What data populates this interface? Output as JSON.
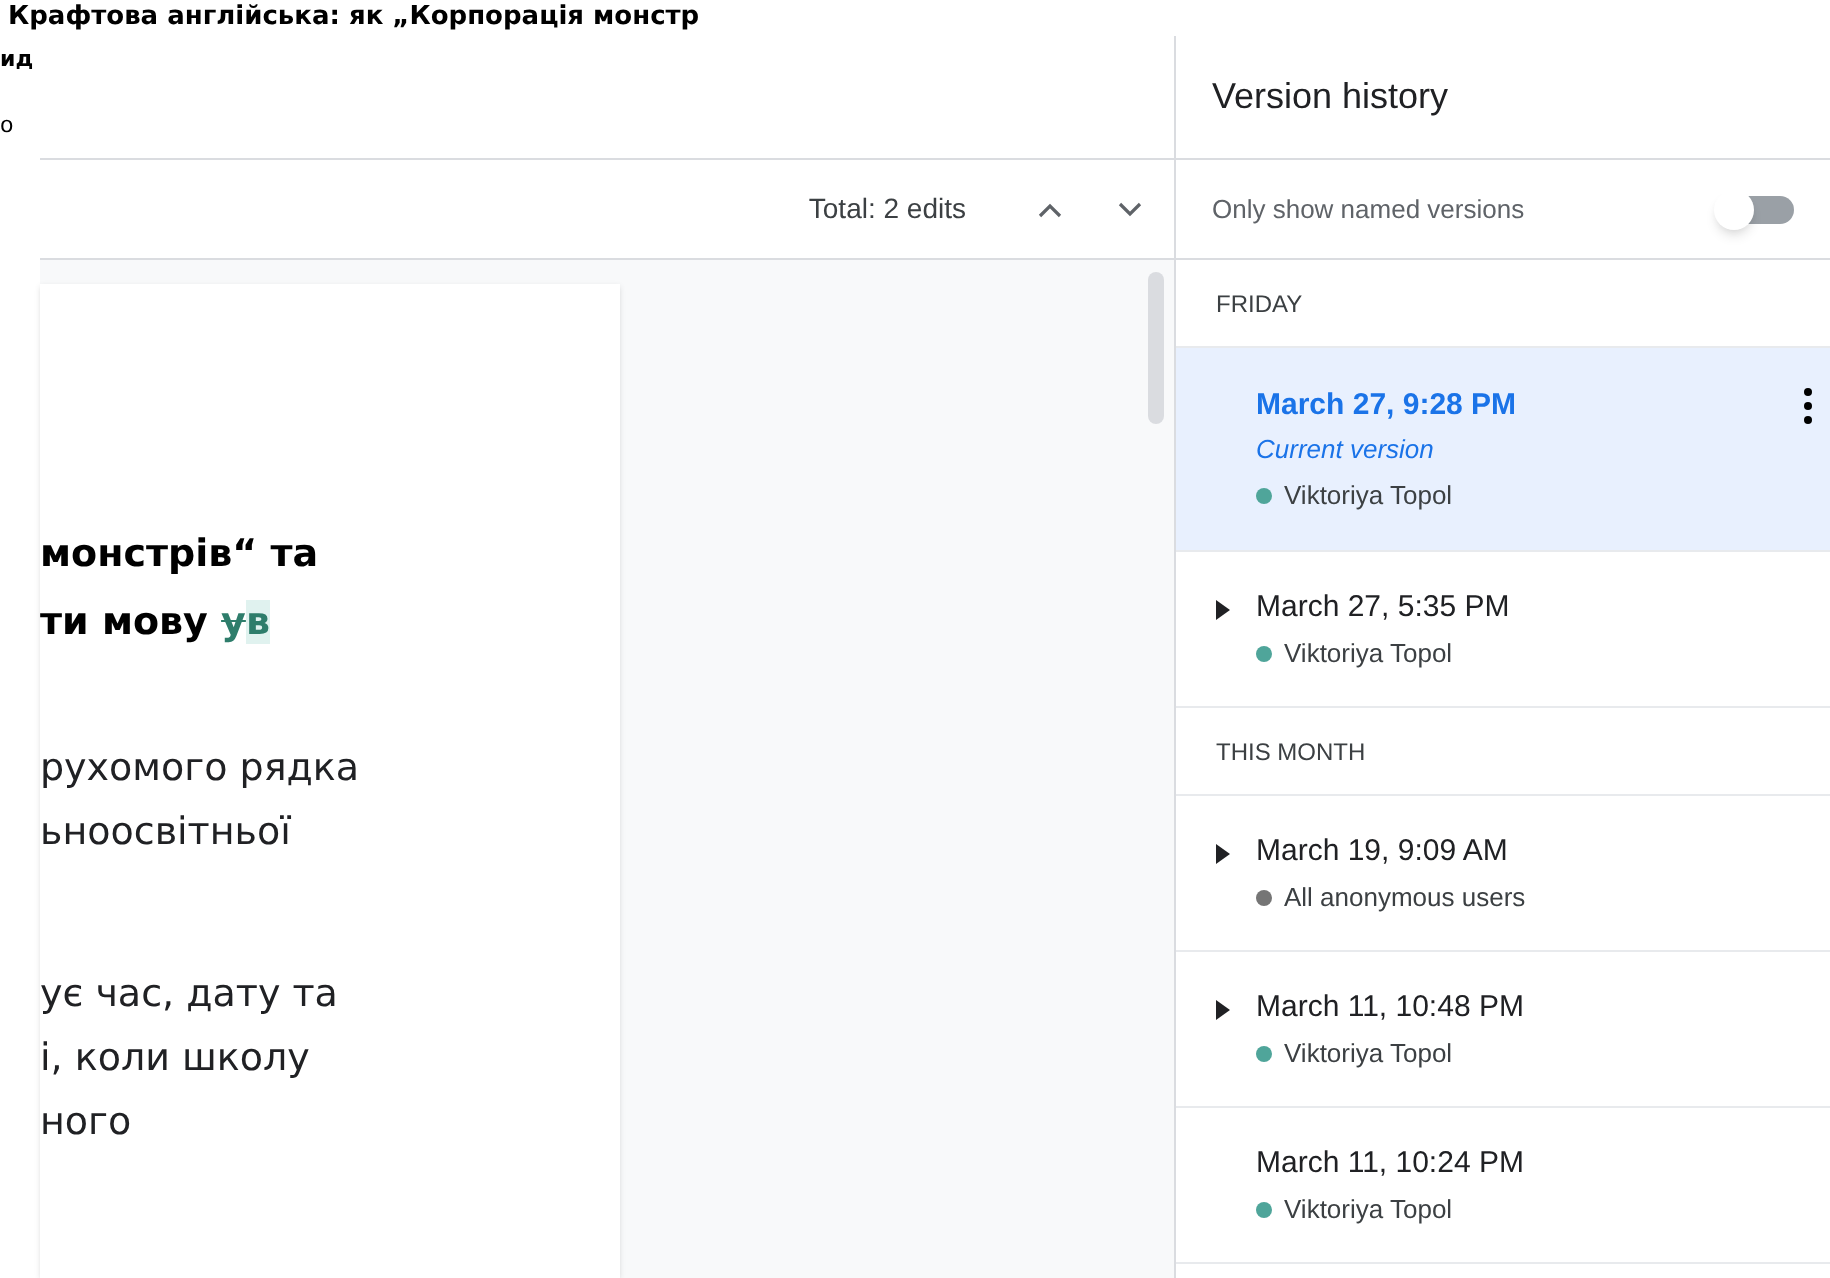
{
  "background_doc": {
    "title": "Крафтова англійська: як „Корпорація монстр",
    "fragments": [
      "ид",
      "о"
    ]
  },
  "compare": {
    "total": "Total: 2 edits"
  },
  "document": {
    "heading_lines": [
      [
        {
          "text": "монстрів“ та",
          "kind": "plain"
        }
      ],
      [
        {
          "text": "ти мову ",
          "kind": "plain"
        },
        {
          "text": "у",
          "kind": "deletion"
        },
        {
          "text": "в",
          "kind": "insertion"
        }
      ]
    ],
    "paragraphs": [
      [
        "рухомого рядка",
        "ьноосвітньої"
      ],
      [
        "ує час, дату та",
        "і, коли школу",
        "ного"
      ]
    ]
  },
  "panel": {
    "title": "Version history",
    "named_toggle": {
      "label": "Only show named versions",
      "on": false
    },
    "groups": [
      {
        "label": "FRIDAY",
        "versions": [
          {
            "time": "March 27, 9:28 PM",
            "note": "Current version",
            "author": "Viktoriya Topol",
            "color": "#4fa59a",
            "selected": true,
            "expandable": false
          },
          {
            "time": "March 27, 5:35 PM",
            "author": "Viktoriya Topol",
            "color": "#4fa59a",
            "selected": false,
            "expandable": true
          }
        ]
      },
      {
        "label": "THIS MONTH",
        "versions": [
          {
            "time": "March 19, 9:09 AM",
            "author": "All anonymous users",
            "color": "#757575",
            "selected": false,
            "expandable": true
          },
          {
            "time": "March 11, 10:48 PM",
            "author": "Viktoriya Topol",
            "color": "#4fa59a",
            "selected": false,
            "expandable": true
          },
          {
            "time": "March 11, 10:24 PM",
            "author": "Viktoriya Topol",
            "color": "#4fa59a",
            "selected": false,
            "expandable": false
          }
        ]
      }
    ]
  }
}
